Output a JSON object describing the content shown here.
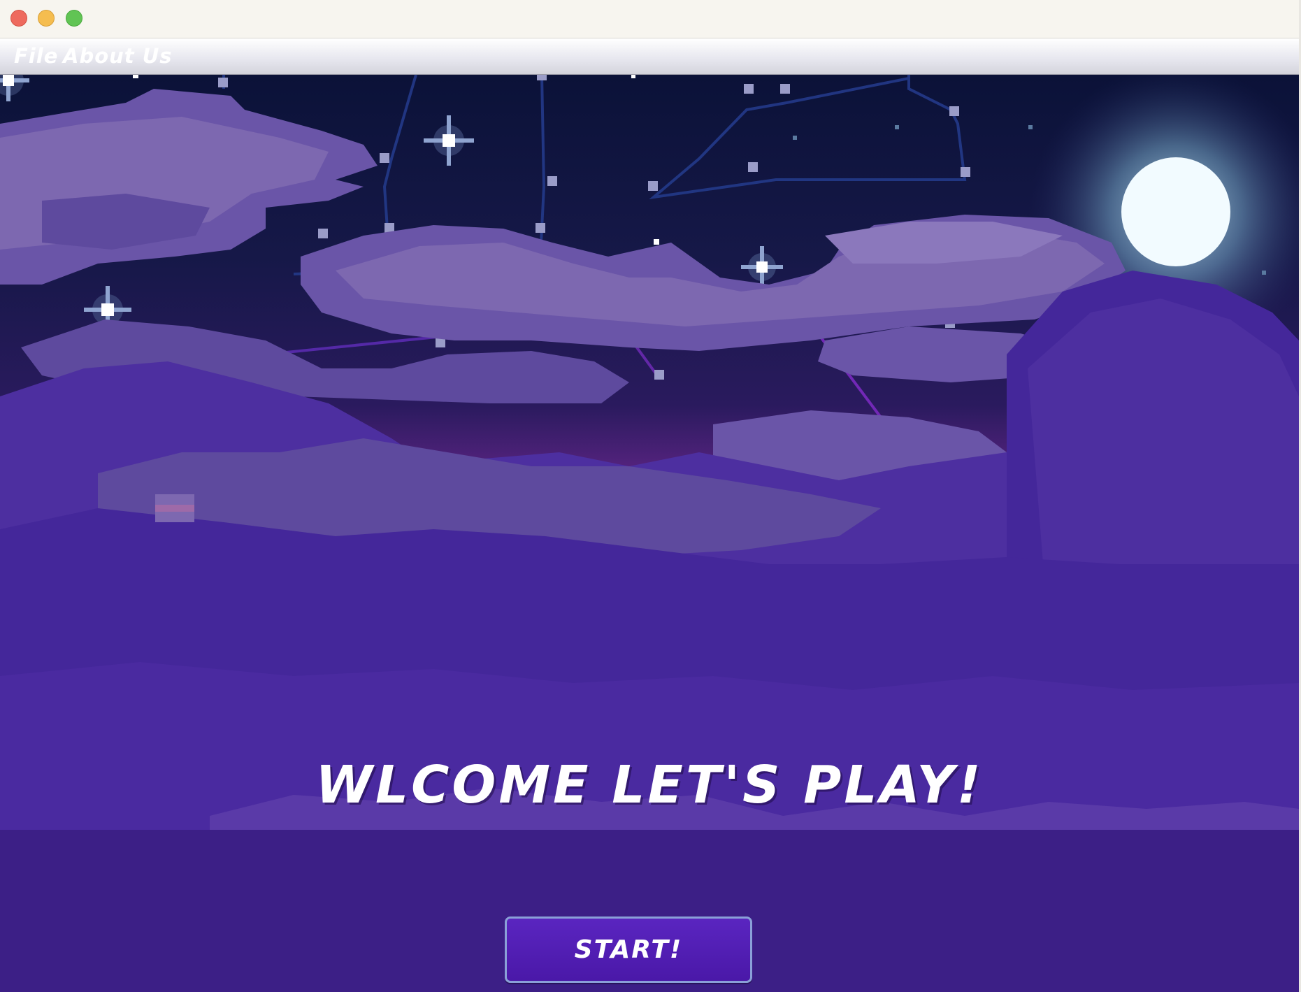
{
  "window": {
    "buttons": [
      "close",
      "minimize",
      "maximize"
    ]
  },
  "menu": {
    "file_label": "File",
    "about_label": "About Us"
  },
  "main": {
    "title": "WLCOME LET'S PLAY!",
    "start_label": "START!"
  },
  "colors": {
    "sky_top": "#0b1238",
    "sky_mid": "#2a1a5e",
    "horizon": "#6a2a8a",
    "cloud_light": "#7d68b0",
    "cloud_mid": "#5e4a9e",
    "cloud_dark": "#44279a",
    "ground": "#3c1f86",
    "moon": "#f2fbff",
    "button": "#4f1bb0",
    "text": "#ffffff"
  }
}
